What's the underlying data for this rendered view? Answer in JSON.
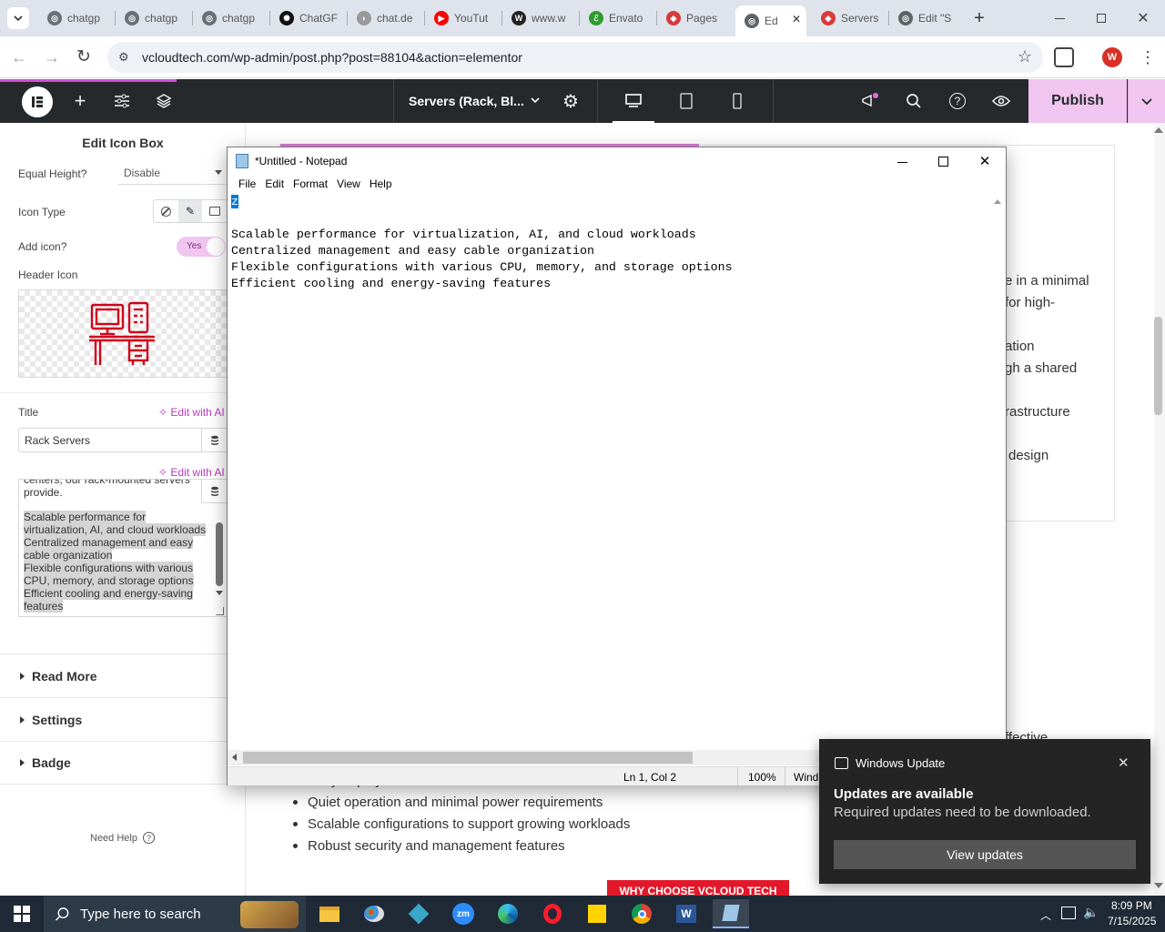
{
  "browser": {
    "tabs": [
      {
        "label": "chatgp",
        "icon": "chatgpt-icon"
      },
      {
        "label": "chatgp",
        "icon": "chatgpt-icon"
      },
      {
        "label": "chatgp",
        "icon": "chatgpt-icon"
      },
      {
        "label": "ChatGF",
        "icon": "openai-icon"
      },
      {
        "label": "chat.de",
        "icon": "deepseek-icon"
      },
      {
        "label": "YouTut",
        "icon": "youtube-icon"
      },
      {
        "label": "www.w",
        "icon": "w-icon"
      },
      {
        "label": "Envato",
        "icon": "envato-icon"
      },
      {
        "label": "Pages",
        "icon": "pages-icon"
      },
      {
        "label": "Ed",
        "icon": "globe-icon",
        "active": true
      },
      {
        "label": "Servers",
        "icon": "pages-icon"
      },
      {
        "label": "Edit \"S",
        "icon": "globe-icon"
      }
    ],
    "url": "vcloudtech.com/wp-admin/post.php?post=88104&action=elementor",
    "profile_initial": "W"
  },
  "elementor": {
    "page_title": "Servers (Rack, Bl...",
    "publish_label": "Publish",
    "panel": {
      "heading": "Edit Icon Box",
      "equal_height_label": "Equal Height?",
      "equal_height_value": "Disable",
      "icon_type_label": "Icon Type",
      "add_icon_label": "Add icon?",
      "add_icon_toggle": "Yes",
      "header_icon_label": "Header Icon",
      "title_label": "Title",
      "edit_ai_label": "Edit with AI",
      "title_value": "Rack Servers",
      "textarea_partial": "centers, our rack-mounted servers provide.",
      "textarea_lines": [
        "Scalable performance for",
        "virtualization, AI, and cloud workloads",
        "Centralized management and easy",
        "cable organization",
        "Flexible configurations with various",
        "CPU, memory, and storage options",
        "Efficient cooling and energy-saving",
        "features"
      ],
      "sections": [
        "Read More",
        "Settings",
        "Badge"
      ],
      "need_help": "Need Help"
    },
    "canvas": {
      "right_fragments": [
        "e in a minimal",
        "for high-",
        "ation",
        "gh a shared",
        "rastructure",
        "design",
        "ffective"
      ],
      "bullets_top_partial": "Easy deployment without the need for racks or extensive infrastructure",
      "bullets": [
        "Quiet operation and minimal power requirements",
        "Scalable configurations to support growing workloads",
        "Robust security and management features"
      ],
      "banner": "WHY CHOOSE VCLOUD TECH"
    }
  },
  "notepad": {
    "title": "*Untitled - Notepad",
    "menu": [
      "File",
      "Edit",
      "Format",
      "View",
      "Help"
    ],
    "selected_char": "z",
    "lines": [
      "",
      "Scalable performance for virtualization, AI, and cloud workloads",
      "Centralized management and easy cable organization",
      "Flexible configurations with various CPU, memory, and storage options",
      "Efficient cooling and energy-saving features"
    ],
    "status_position": "Ln 1, Col 2",
    "status_zoom": "100%",
    "status_eol": "Wind"
  },
  "toast": {
    "app": "Windows Update",
    "title": "Updates are available",
    "body": "Required updates need to be downloaded.",
    "button": "View updates"
  },
  "taskbar": {
    "search_placeholder": "Type here to search",
    "time": "8:09 PM",
    "date": "7/15/2025"
  },
  "colors": {
    "elementor_dark": "#26292c",
    "publish_bg": "#f0c5f0",
    "accent_pink": "#c036c0",
    "icon_red": "#d0021b",
    "banner_red": "#e2182a"
  }
}
